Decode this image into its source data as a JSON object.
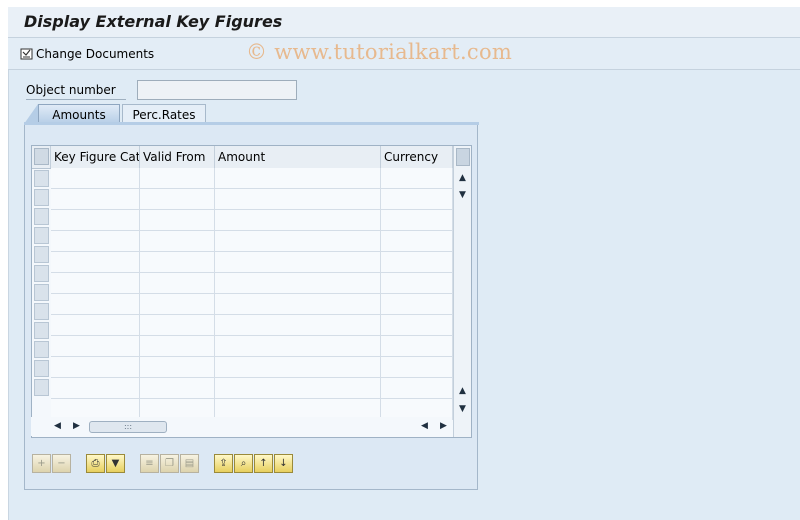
{
  "window": {
    "title": "Display External Key Figures"
  },
  "toolbar": {
    "change_documents_label": "Change Documents"
  },
  "watermark": "© www.tutorialkart.com",
  "form": {
    "object_number_label": "Object number",
    "object_number_value": ""
  },
  "tabs": [
    {
      "label": "Amounts",
      "active": true
    },
    {
      "label": "Perc.Rates",
      "active": false
    }
  ],
  "table": {
    "columns": [
      "Key Figure Cat.",
      "Valid From",
      "Amount",
      "Currency"
    ],
    "rows": [
      [
        "",
        "",
        "",
        ""
      ],
      [
        "",
        "",
        "",
        ""
      ],
      [
        "",
        "",
        "",
        ""
      ],
      [
        "",
        "",
        "",
        ""
      ],
      [
        "",
        "",
        "",
        ""
      ],
      [
        "",
        "",
        "",
        ""
      ],
      [
        "",
        "",
        "",
        ""
      ],
      [
        "",
        "",
        "",
        ""
      ],
      [
        "",
        "",
        "",
        ""
      ],
      [
        "",
        "",
        "",
        ""
      ],
      [
        "",
        "",
        "",
        ""
      ],
      [
        "",
        "",
        "",
        ""
      ]
    ]
  },
  "buttons": [
    "append-row-icon",
    "delete-row-icon",
    "print-icon",
    "filter-icon",
    "details-icon",
    "copy-icon",
    "paste-icon",
    "export-icon",
    "find-icon",
    "sort-ascending-icon",
    "sort-descending-icon"
  ],
  "colors": {
    "panel": "#dce8f4",
    "tab_active": "#b5cde6",
    "button_face": "#e7cf5e"
  }
}
